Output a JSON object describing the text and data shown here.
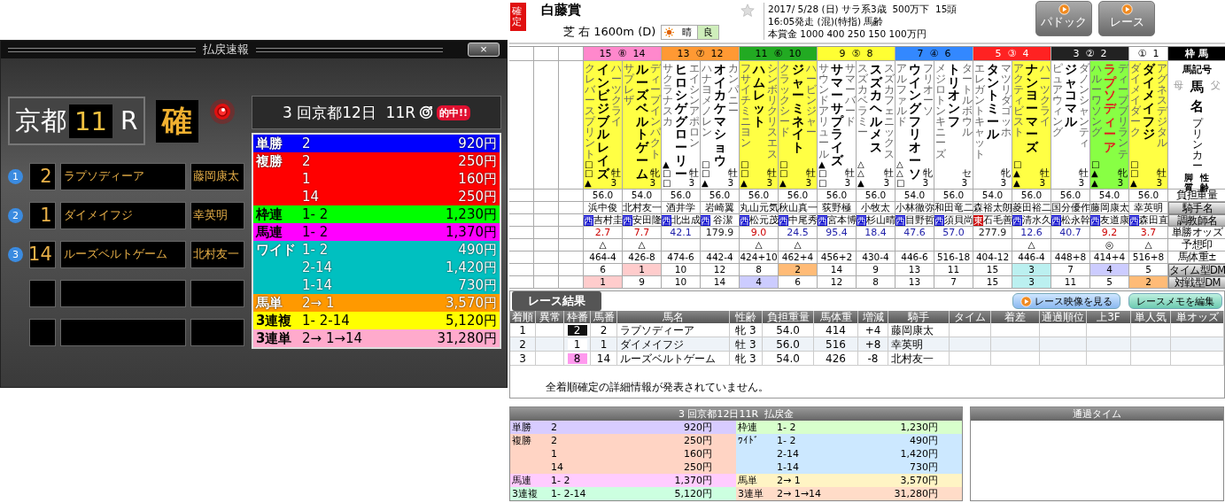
{
  "payout_window": {
    "title": "払戻速報",
    "close": "×",
    "venue": "京都",
    "race_no": "11",
    "race_suffix": "R",
    "status": "確",
    "race_title": "3 回京都12日  11R",
    "hit_badge": "的中!!",
    "finishers": [
      {
        "kind": "placed",
        "rank": "1",
        "number": "2",
        "name": "ラプソディーア",
        "jockey": "藤岡康太"
      },
      {
        "kind": "placed",
        "rank": "2",
        "number": "1",
        "name": "ダイメイフジ",
        "jockey": "幸英明"
      },
      {
        "kind": "placed",
        "rank": "3",
        "number": "14",
        "name": "ルーズベルトゲーム",
        "jockey": "北村友一"
      },
      {
        "kind": "empty"
      },
      {
        "kind": "empty"
      }
    ],
    "payouts": [
      {
        "type": "単勝",
        "color": "#0000ff",
        "light_text": true,
        "entries": [
          {
            "combo": "2",
            "amount": "920円"
          }
        ]
      },
      {
        "type": "複勝",
        "color": "#ff0000",
        "light_text": true,
        "entries": [
          {
            "combo": "2",
            "amount": "250円"
          },
          {
            "combo": "1",
            "amount": "160円"
          },
          {
            "combo": "14",
            "amount": "250円"
          }
        ]
      },
      {
        "type": "枠連",
        "color": "#00ff00",
        "light_text": false,
        "entries": [
          {
            "combo": "1- 2",
            "amount": "1,230円"
          }
        ]
      },
      {
        "type": "馬連",
        "color": "#ff00ff",
        "light_text": false,
        "entries": [
          {
            "combo": "1- 2",
            "amount": "1,370円"
          }
        ]
      },
      {
        "type": "ワイド",
        "color": "#00c0c0",
        "light_text": true,
        "entries": [
          {
            "combo": "1- 2",
            "amount": "490円"
          },
          {
            "combo": "2-14",
            "amount": "1,420円"
          },
          {
            "combo": "1-14",
            "amount": "730円"
          }
        ]
      },
      {
        "type": "馬単",
        "color": "#ff9900",
        "light_text": true,
        "entries": [
          {
            "combo": "2→ 1",
            "amount": "3,570円"
          }
        ]
      },
      {
        "type": "3連複",
        "color": "#ffff00",
        "light_text": false,
        "entries": [
          {
            "combo": "1- 2-14",
            "amount": "5,120円"
          }
        ]
      },
      {
        "type": "3連単",
        "color": "#ffaacc",
        "light_text": false,
        "entries": [
          {
            "combo": "2→ 1→14",
            "amount": "31,280円"
          }
        ]
      }
    ]
  },
  "race_header": {
    "confirmed": "確定",
    "name": "白藤賞",
    "favorite": false,
    "course": "芝 右 1600m (D)",
    "weather": "晴",
    "going": "良",
    "info": [
      "2017/ 5/28 (日) サラ系3歳  500万下  15頭",
      "16:05発走 (混)(特指) 馬齢",
      "本賞金 1000 400 250 150 100万円"
    ],
    "buttons": [
      "パドック",
      "レース"
    ]
  },
  "entry_table": {
    "corner_label": "枠 馬",
    "name_labels": [
      "馬記号",
      "母",
      "馬",
      "父",
      "名",
      "プリンカー",
      "脚質",
      "性齢"
    ],
    "row_labels": [
      {
        "text": "負担重量",
        "kind": "text"
      },
      {
        "text": "騎手名",
        "kind": "button"
      },
      {
        "text": "調教師名",
        "kind": "button"
      },
      {
        "text": "単勝オッズ",
        "kind": "text"
      },
      {
        "text": "予想印",
        "kind": "text"
      },
      {
        "text": "馬体重±",
        "kind": "text"
      },
      {
        "text": "タイム型DM",
        "kind": "button"
      },
      {
        "text": "対戦型DM",
        "kind": "button"
      }
    ],
    "frames": [
      {
        "parts": [
          "15",
          "⑧",
          "14"
        ],
        "color": "#ff88cc"
      },
      {
        "parts": [
          "13",
          "⑦",
          "12"
        ],
        "color": "#ff9933"
      },
      {
        "parts": [
          "11",
          "⑥",
          "10"
        ],
        "color": "#22aa22"
      },
      {
        "parts": [
          "9",
          "⑤",
          "8"
        ],
        "color": "#ffff33"
      },
      {
        "parts": [
          "7",
          "④",
          "6"
        ],
        "color": "#3388ff"
      },
      {
        "parts": [
          "5",
          "③",
          "4"
        ],
        "color": "#ff2222"
      },
      {
        "parts": [
          "3",
          "②",
          "2"
        ],
        "color": "#222222"
      },
      {
        "parts": [
          "①",
          "1"
        ],
        "color": "#ffffff"
      }
    ],
    "horses": [
      {
        "name": "インビジブルレイズ",
        "dam": "クレバースプリント",
        "sire": "ハーツクライ",
        "sex_age": "牡3",
        "color": "#ffff44",
        "winner": false,
        "marks": "□□▲",
        "weight": "56.0",
        "jockey": "浜中俊",
        "region": {
          "text": "西",
          "color": "#0000cc"
        },
        "trainer": "吉村圭",
        "odds": {
          "text": "2.7",
          "color": "#cc0000"
        },
        "pick": "△",
        "body_weight": "464-4",
        "time_dm": {
          "text": "6",
          "color": "#ffffff"
        },
        "battle_dm": {
          "text": "1",
          "color": "#ffcccc"
        }
      },
      {
        "name": "ルーズベルトゲーム",
        "dam": "サプレザ",
        "sire": "ディープインパクト",
        "sex_age": "牝3",
        "color": "#ffff44",
        "winner": false,
        "weight": "54.0",
        "jockey": "北村友一",
        "region": {
          "text": "西",
          "color": "#0000cc"
        },
        "trainer": "安田隆",
        "odds": {
          "text": "7.7",
          "color": "#cc0000"
        },
        "pick": "△",
        "body_weight": "426-8",
        "time_dm": {
          "text": "1",
          "color": "#ffcccc"
        },
        "battle_dm": {
          "text": "9",
          "color": "#ffffff"
        }
      },
      {
        "name": "ヒロシゲグローリー",
        "dam": "サクラナスカ",
        "sire": "エイシンアポロン",
        "sex_age": "牡3",
        "color": "#ffffff",
        "winner": false,
        "marks": "▲□□",
        "weight": "56.0",
        "jockey": "酒井学",
        "region": {
          "text": "西",
          "color": "#0000cc"
        },
        "trainer": "北出成",
        "odds": {
          "text": "42.1",
          "color": "#2222aa"
        },
        "body_weight": "474-6",
        "time_dm": {
          "text": "10",
          "color": "#ffffff"
        },
        "battle_dm": {
          "text": "10",
          "color": "#ffffff"
        }
      },
      {
        "name": "オイカケマショウ",
        "dam": "ハナヨメノレン",
        "sire": "カンパニー",
        "sex_age": "牡3",
        "color": "#ffffff",
        "winner": false,
        "marks": "□□▲",
        "weight": "56.0",
        "jockey": "岩崎翼",
        "region": {
          "text": "西",
          "color": "#0000cc"
        },
        "trainer": " 谷潔",
        "odds": {
          "text": "179.9",
          "color": "#222222"
        },
        "body_weight": "442-4",
        "time_dm": {
          "text": "12",
          "color": "#ffffff"
        },
        "battle_dm": {
          "text": "14",
          "color": "#ffffff"
        }
      },
      {
        "name": "ハムレット",
        "dam": "フサイチミニヨン",
        "sire": "シンボリクリスエス",
        "sex_age": "牡3",
        "color": "#ffff44",
        "winner": false,
        "marks": "□□▲",
        "weight": "56.0",
        "jockey": "丸山元気",
        "region": {
          "text": "西",
          "color": "#0000cc"
        },
        "trainer": "松元茂",
        "odds": {
          "text": "9.0",
          "color": "#cc0000"
        },
        "pick": "△",
        "body_weight": "424+10",
        "time_dm": {
          "text": "8",
          "color": "#ffffff"
        },
        "battle_dm": {
          "text": "4",
          "color": "#ccccff"
        }
      },
      {
        "name": "ジャーミネイト",
        "dam": "クラックシード",
        "sire": "ハービンジャー",
        "sex_age": "牡3",
        "color": "#ffff44",
        "winner": false,
        "marks": "□□▲",
        "weight": "56.0",
        "jockey": "秋山真一",
        "region": {
          "text": "西",
          "color": "#0000cc"
        },
        "trainer": "中尾秀",
        "odds": {
          "text": "24.5",
          "color": "#2222aa"
        },
        "pick": "△",
        "body_weight": "462+4",
        "time_dm": {
          "text": "2",
          "color": "#ffbb77"
        },
        "battle_dm": {
          "text": "6",
          "color": "#ffffff"
        }
      },
      {
        "name": "サマーサプライズ",
        "dam": "サウンドアリュール",
        "sire": "サマーバード",
        "sex_age": "牡3",
        "color": "#ffffff",
        "winner": false,
        "marks": "▲□□",
        "weight": "56.0",
        "jockey": "荻野極",
        "region": {
          "text": "西",
          "color": "#0000cc"
        },
        "trainer": "宮本博",
        "odds": {
          "text": "95.4",
          "color": "#2222aa"
        },
        "body_weight": "456+2",
        "time_dm": {
          "text": "14",
          "color": "#ffffff"
        },
        "battle_dm": {
          "text": "12",
          "color": "#ffffff"
        }
      },
      {
        "name": "スズカヘルメス",
        "dam": "スズカベラミー",
        "sire": "スズカフェニックス",
        "sex_age": "牡3",
        "color": "#ffffff",
        "winner": false,
        "marks": "△△▲",
        "weight": "56.0",
        "jockey": "小牧太",
        "region": {
          "text": "西",
          "color": "#0000cc"
        },
        "trainer": "杉山晴",
        "odds": {
          "text": "18.4",
          "color": "#2222aa"
        },
        "body_weight": "430-4",
        "time_dm": {
          "text": "9",
          "color": "#ffffff"
        },
        "battle_dm": {
          "text": "8",
          "color": "#ffffff"
        }
      },
      {
        "name": "ウイングフリオーソ",
        "dam": "アルファルド",
        "sire": "フリオーソ",
        "sex_age": "牝3",
        "color": "#ffffff",
        "winner": false,
        "marks": "△△□",
        "weight": "54.0",
        "jockey": "小林徹弥",
        "region": {
          "text": "西",
          "color": "#0000cc"
        },
        "trainer": "目野哲",
        "odds": {
          "text": "47.6",
          "color": "#2222aa"
        },
        "body_weight": "446-6",
        "time_dm": {
          "text": "13",
          "color": "#ffffff"
        },
        "battle_dm": {
          "text": "13",
          "color": "#ffffff"
        }
      },
      {
        "name": "トリオンフ",
        "dam": "メジロトンキニーズ",
        "sire": "タートルボウル",
        "sex_age": "セ3",
        "color": "#ffffff",
        "winner": false,
        "weight": "56.0",
        "jockey": "和田竜二",
        "region": {
          "text": "西",
          "color": "#0000cc"
        },
        "trainer": "須貝尚",
        "odds": {
          "text": "57.0",
          "color": "#2222aa"
        },
        "body_weight": "516-18",
        "time_dm": {
          "text": "11",
          "color": "#ffffff"
        },
        "battle_dm": {
          "text": "7",
          "color": "#ffffff"
        }
      },
      {
        "name": "タントミール",
        "dam": "エレガントキャット",
        "sire": "マツリダゴッホ",
        "sex_age": "牝3",
        "color": "#ffffff",
        "winner": false,
        "weight": "54.0",
        "jockey": "森裕太朗",
        "region": {
          "text": "東",
          "color": "#cc0000"
        },
        "trainer": "石毛善",
        "odds": {
          "text": "277.9",
          "color": "#222222"
        },
        "body_weight": "404-12",
        "time_dm": {
          "text": "15",
          "color": "#ffffff"
        },
        "battle_dm": {
          "text": "15",
          "color": "#ffffff"
        }
      },
      {
        "name": "ナンヨーマーズ",
        "dam": "アクティビスト",
        "sire": "ハーツクライ",
        "sex_age": "牡3",
        "color": "#ffff44",
        "winner": false,
        "marks": "□▲▲",
        "weight": "56.0",
        "jockey": "菱田裕二",
        "region": {
          "text": "西",
          "color": "#0000cc"
        },
        "trainer": "清水久",
        "odds": {
          "text": "12.6",
          "color": "#2222aa"
        },
        "pick": "△",
        "body_weight": "446-4",
        "time_dm": {
          "text": "3",
          "color": "#bbf0f0"
        },
        "battle_dm": {
          "text": "3",
          "color": "#bbf0f0"
        }
      },
      {
        "name": "ジャコマル",
        "dam": "ピュアウィング",
        "sire": "ダノンシャンティ",
        "sex_age": "牡3",
        "color": "#ffffff",
        "winner": false,
        "weight": "56.0",
        "jockey": "国分優作",
        "region": {
          "text": "西",
          "color": "#0000cc"
        },
        "trainer": "松永幹",
        "odds": {
          "text": "40.7",
          "color": "#2222aa"
        },
        "body_weight": "448+8",
        "time_dm": {
          "text": "7",
          "color": "#ffffff"
        },
        "battle_dm": {
          "text": "11",
          "color": "#ffffff"
        }
      },
      {
        "name": "ラプソディーア",
        "dam": "ハルーワソング",
        "sire": "ディープブリランテ",
        "sex_age": "牝3",
        "color": "#88ff44",
        "winner": true,
        "marks": "□▲▲",
        "weight": "54.0",
        "jockey": "藤岡康太",
        "region": {
          "text": "西",
          "color": "#0000cc"
        },
        "trainer": "友道康",
        "odds": {
          "text": "9.2",
          "color": "#cc0000"
        },
        "pick": "◎",
        "body_weight": "414+4",
        "time_dm": {
          "text": "4",
          "color": "#ccccff"
        },
        "battle_dm": {
          "text": "5",
          "color": "#ffffff"
        }
      },
      {
        "name": "ダイメイフジ",
        "dam": "ダイメイダーク",
        "sire": "アグネスデジタル",
        "sex_age": "牡3",
        "color": "#ffff44",
        "winner": false,
        "marks": "□□▲",
        "weight": "56.0",
        "jockey": "幸英明",
        "region": {
          "text": "西",
          "color": "#0000cc"
        },
        "trainer": "森田直",
        "odds": {
          "text": "3.7",
          "color": "#cc0000"
        },
        "pick": "△",
        "body_weight": "516+8",
        "time_dm": {
          "text": "5",
          "color": "#ffffff"
        },
        "battle_dm": {
          "text": "2",
          "color": "#ffbb77"
        }
      }
    ]
  },
  "results": {
    "title": "レース結果",
    "buttons": [
      {
        "label": "レース映像を見る",
        "kind": "video"
      },
      {
        "label": "レースメモを編集",
        "kind": "memo"
      }
    ],
    "columns": [
      "着順",
      "異常",
      "枠番",
      "馬番",
      "馬名",
      "性齢",
      "負担重量",
      "馬体重",
      "増減",
      "騎手",
      "タイム",
      "着差",
      "通過順位",
      "上3F",
      "単人気",
      "単オッズ"
    ],
    "rows": [
      {
        "rank": "1",
        "frame": "2",
        "color": "#111111",
        "number": "2",
        "name": "ラプソディーア",
        "sex_age": "牝 3",
        "weight": "54.0",
        "body_weight": "414",
        "change": "+4",
        "jockey": "藤岡康太"
      },
      {
        "rank": "2",
        "frame": "1",
        "color": "#ffffff",
        "number": "1",
        "name": "ダイメイフジ",
        "sex_age": "牡 3",
        "weight": "56.0",
        "body_weight": "516",
        "change": "+8",
        "jockey": "幸英明"
      },
      {
        "rank": "3",
        "frame": "8",
        "color": "#ff99ee",
        "number": "14",
        "name": "ルーズベルトゲーム",
        "sex_age": "牝 3",
        "weight": "54.0",
        "body_weight": "426",
        "change": "-8",
        "jockey": "北村友一"
      }
    ],
    "note": "全着順確定の詳細情報が発表されていません。"
  },
  "payout_summary": {
    "title": "3 回京都12日11R  払戻金",
    "left": [
      {
        "type": "単勝",
        "color": "#d8ccff",
        "entries": [
          {
            "combo": "2",
            "amount": "920円"
          }
        ]
      },
      {
        "type": "複勝",
        "color": "#ffd4c4",
        "entries": [
          {
            "combo": "2",
            "amount": "250円"
          },
          {
            "combo": "1",
            "amount": "160円"
          },
          {
            "combo": "14",
            "amount": "250円"
          }
        ]
      },
      {
        "type": "馬連",
        "color": "#ffccff",
        "entries": [
          {
            "combo": "1- 2",
            "amount": "1,370円"
          }
        ]
      },
      {
        "type": "3連複",
        "color": "#ccffe0",
        "entries": [
          {
            "combo": "1- 2-14",
            "amount": "5,120円"
          }
        ]
      }
    ],
    "right": [
      {
        "type": "枠連",
        "color": "#d8ffcc",
        "entries": [
          {
            "combo": "1- 2",
            "amount": "1,230円"
          }
        ]
      },
      {
        "type": "ﾜｲﾄﾞ",
        "color": "#cce8ff",
        "entries": [
          {
            "combo": "1- 2",
            "amount": "490円"
          },
          {
            "combo": "2-14",
            "amount": "1,420円"
          },
          {
            "combo": "1-14",
            "amount": "730円"
          }
        ]
      },
      {
        "type": "馬単",
        "color": "#fff4c4",
        "entries": [
          {
            "combo": "2→ 1",
            "amount": "3,570円"
          }
        ]
      },
      {
        "type": "3連単",
        "color": "#ffdcc8",
        "entries": [
          {
            "combo": "2→ 1→14",
            "amount": "31,280円"
          }
        ]
      }
    ]
  },
  "passing_time": {
    "title": "通過タイム"
  }
}
